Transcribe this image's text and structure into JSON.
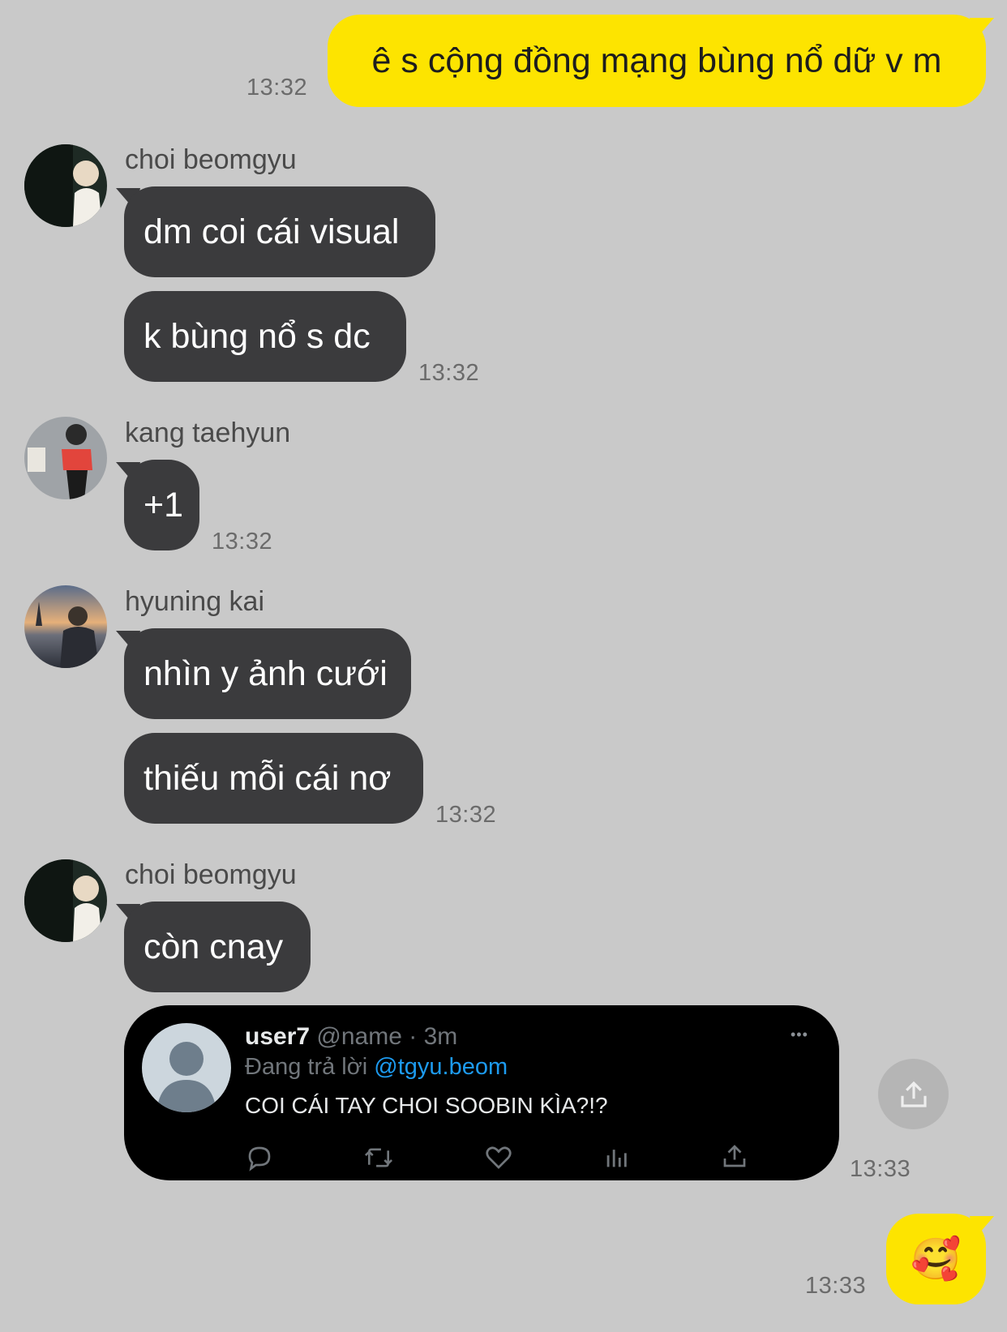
{
  "messages": {
    "m1": {
      "text": "ê s cộng đồng mạng bùng nổ dữ v m",
      "time": "13:32"
    },
    "g1": {
      "sender": "choi beomgyu",
      "lines": [
        "dm coi cái visual",
        "k bùng nổ s dc"
      ],
      "time": "13:32"
    },
    "g2": {
      "sender": "kang taehyun",
      "lines": [
        "+1"
      ],
      "time": "13:32"
    },
    "g3": {
      "sender": "hyuning kai",
      "lines": [
        "nhìn y ảnh cưới",
        "thiếu mỗi cái nơ"
      ],
      "time": "13:32"
    },
    "g4": {
      "sender": "choi beomgyu",
      "lines": [
        "còn cnay"
      ],
      "time": "13:33",
      "tweet": {
        "user": "user7",
        "handle": "@name · 3m",
        "replying_prefix": "Đang trả lời",
        "replying_to": "@tgyu.beom",
        "text": "COI CÁI TAY CHOI SOOBIN KÌA?!?",
        "more": "•••"
      }
    },
    "m2": {
      "emoji": "🥰",
      "time": "13:33"
    }
  },
  "colors": {
    "background": "#c9c9c9",
    "outgoing": "#fde400",
    "incoming": "#3b3b3d",
    "link": "#1d9bf0"
  },
  "icons": [
    "reply-icon",
    "retweet-icon",
    "like-icon",
    "analytics-icon",
    "share-icon",
    "share-upload-icon",
    "default-avatar-icon"
  ]
}
